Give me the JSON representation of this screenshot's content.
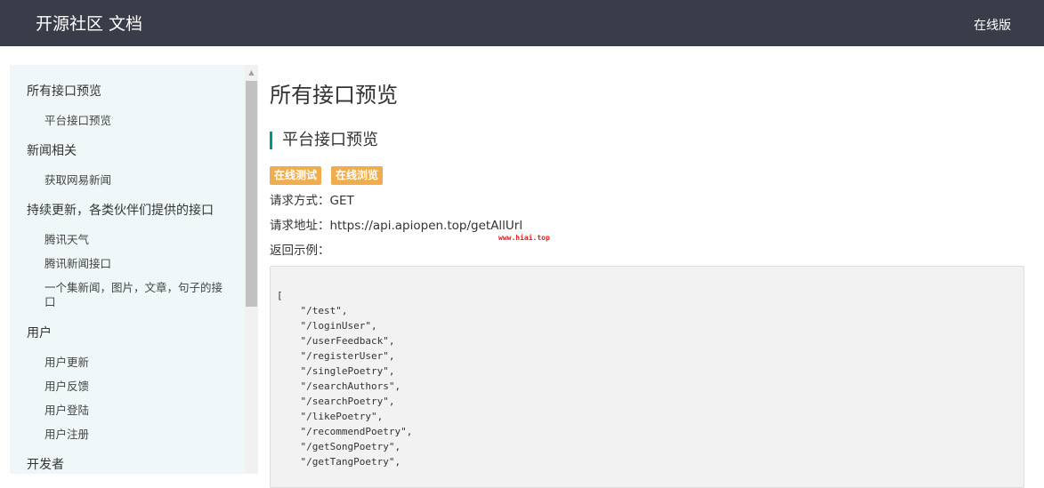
{
  "header": {
    "brand": "开源社区 文档",
    "online_link": "在线版"
  },
  "sidebar": {
    "items": [
      {
        "label": "所有接口预览",
        "level": 1
      },
      {
        "label": "平台接口预览",
        "level": 2
      },
      {
        "label": "新闻相关",
        "level": 1
      },
      {
        "label": "获取网易新闻",
        "level": 2
      },
      {
        "label": "持续更新，各类伙伴们提供的接口",
        "level": 1
      },
      {
        "label": "腾讯天气",
        "level": 2
      },
      {
        "label": "腾讯新闻接口",
        "level": 2
      },
      {
        "label": "一个集新闻，图片，文章，句子的接口",
        "level": 2
      },
      {
        "label": "用户",
        "level": 1
      },
      {
        "label": "用户更新",
        "level": 2
      },
      {
        "label": "用户反馈",
        "level": 2
      },
      {
        "label": "用户登陆",
        "level": 2
      },
      {
        "label": "用户注册",
        "level": 2
      },
      {
        "label": "开发者",
        "level": 1
      }
    ]
  },
  "main": {
    "title": "所有接口预览",
    "section_title": "平台接口预览",
    "badges": {
      "test": "在线测试",
      "browse": "在线浏览"
    },
    "method_line": "请求方式：GET",
    "url_line": "请求地址：https://api.apiopen.top/getAllUrl",
    "example_label": "返回示例：",
    "watermark": "www.hiai.top",
    "code_lines": [
      "[",
      "    \"/test\",",
      "    \"/loginUser\",",
      "    \"/userFeedback\",",
      "    \"/registerUser\",",
      "    \"/singlePoetry\",",
      "    \"/searchAuthors\",",
      "    \"/searchPoetry\",",
      "    \"/likePoetry\",",
      "    \"/recommendPoetry\",",
      "    \"/getSongPoetry\",",
      "    \"/getTangPoetry\","
    ]
  },
  "colors": {
    "header_bg": "#393d49",
    "sidebar_bg": "#eff7f9",
    "accent": "#009688",
    "badge": "#f0ad4e",
    "code_bg": "#f2f2f2"
  }
}
